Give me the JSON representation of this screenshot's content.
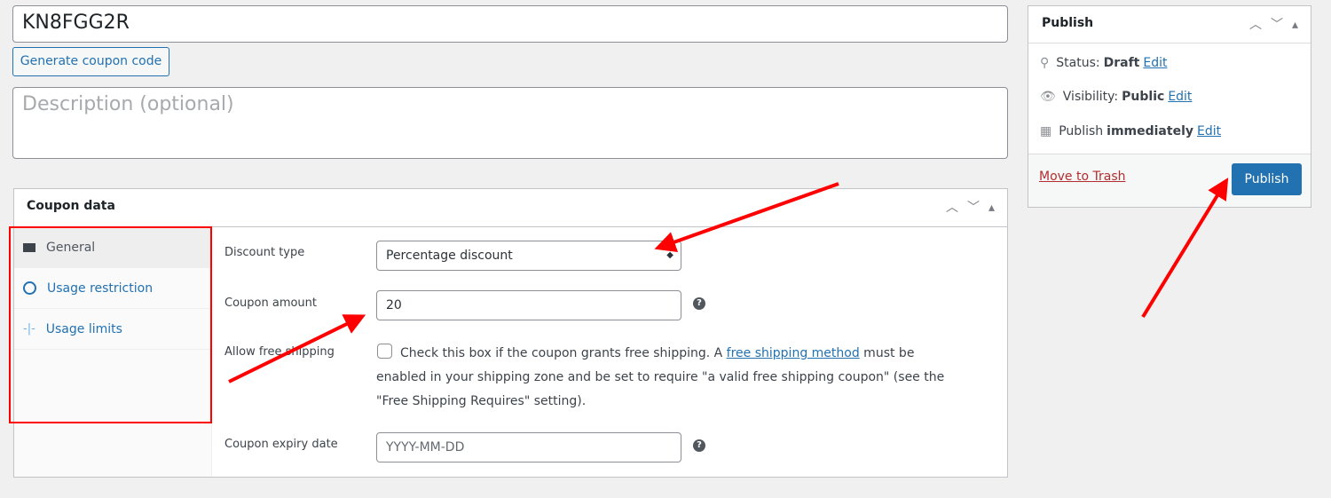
{
  "coupon_code": "KN8FGG2R",
  "generate_button": "Generate coupon code",
  "description_placeholder": "Description (optional)",
  "coupon_data": {
    "title": "Coupon data",
    "tabs": [
      {
        "label": "General",
        "icon": "ticket-icon"
      },
      {
        "label": "Usage restriction",
        "icon": "no-entry-icon"
      },
      {
        "label": "Usage limits",
        "icon": "limits-icon"
      }
    ],
    "discount_type_label": "Discount type",
    "discount_type_value": "Percentage discount",
    "amount_label": "Coupon amount",
    "amount_value": "20",
    "free_shipping_label": "Allow free shipping",
    "free_shipping_text_1": "Check this box if the coupon grants free shipping. A ",
    "free_shipping_link": "free shipping method",
    "free_shipping_text_2": " must be enabled in your shipping zone and be set to require \"a valid free shipping coupon\" (see the \"Free Shipping Requires\" setting).",
    "free_shipping_checked": false,
    "expiry_label": "Coupon expiry date",
    "expiry_placeholder": "YYYY-MM-DD",
    "help": "?"
  },
  "publish": {
    "title": "Publish",
    "status_label": "Status:",
    "status_value": "Draft",
    "visibility_label": "Visibility:",
    "visibility_value": "Public",
    "schedule_label": "Publish",
    "schedule_value": "immediately",
    "edit": "Edit",
    "trash": "Move to Trash",
    "button": "Publish"
  },
  "colors": {
    "accent": "#2271b1",
    "annotation": "#ff0000",
    "trash": "#b32d2e"
  }
}
